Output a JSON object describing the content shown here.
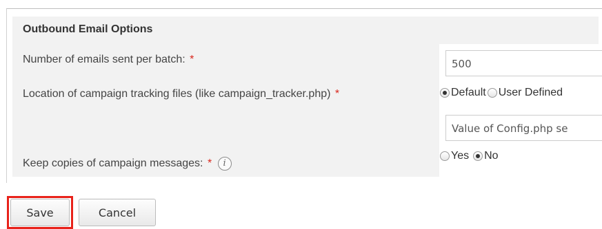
{
  "section": {
    "title": "Outbound Email Options"
  },
  "fields": {
    "batch": {
      "label": "Number of emails sent per batch:",
      "required_mark": "*",
      "value": "500"
    },
    "tracking": {
      "label": "Location of campaign tracking files (like campaign_tracker.php)",
      "required_mark": "*",
      "options": [
        "Default",
        "User Defined"
      ],
      "selected": "Default",
      "value": "Value of Config.php se"
    },
    "keep_copies": {
      "label": "Keep copies of campaign messages:",
      "required_mark": "*",
      "info_icon": "i",
      "options": [
        "Yes",
        "No"
      ],
      "selected": "No"
    }
  },
  "actions": {
    "save_label": "Save",
    "cancel_label": "Cancel"
  },
  "colors": {
    "required": "#d9261c",
    "highlight": "#e8221a",
    "panel_bg": "#f2f2f2"
  }
}
